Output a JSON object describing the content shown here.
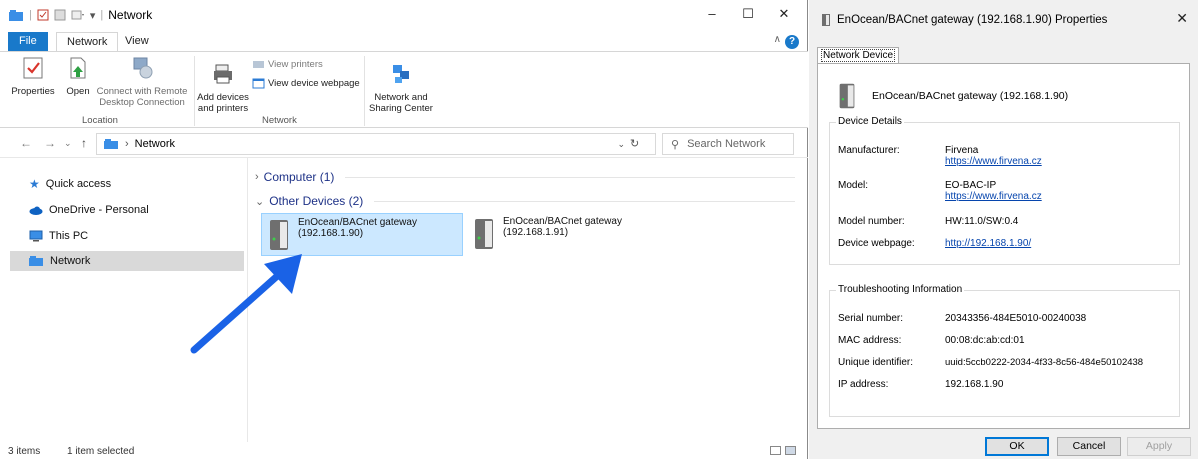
{
  "explorer": {
    "title": "Network",
    "tabs": {
      "file": "File",
      "network": "Network",
      "view": "View"
    },
    "ribbon": {
      "location_group": "Location",
      "network_group": "Network",
      "properties": "Properties",
      "open": "Open",
      "connect_remote_1": "Connect with Remote",
      "connect_remote_2": "Desktop Connection",
      "add_devices_1": "Add devices",
      "add_devices_2": "and printers",
      "view_printers": "View printers",
      "view_device_webpage": "View device webpage",
      "network_sharing_1": "Network and",
      "network_sharing_2": "Sharing Center"
    },
    "address": {
      "path": "Network",
      "search_placeholder": "Search Network"
    },
    "nav": {
      "quick_access": "Quick access",
      "onedrive": "OneDrive - Personal",
      "this_pc": "This PC",
      "network": "Network"
    },
    "sections": {
      "computer": "Computer (1)",
      "other_devices": "Other Devices (2)"
    },
    "devices": [
      {
        "name": "EnOcean/BACnet gateway",
        "ip": "(192.168.1.90)"
      },
      {
        "name": "EnOcean/BACnet gateway",
        "ip": "(192.168.1.91)"
      }
    ],
    "status": {
      "items": "3 items",
      "selected": "1 item selected"
    }
  },
  "properties": {
    "title": "EnOcean/BACnet gateway (192.168.1.90) Properties",
    "tab": "Network Device",
    "device_name": "EnOcean/BACnet gateway (192.168.1.90)",
    "details_legend": "Device Details",
    "manufacturer_label": "Manufacturer:",
    "manufacturer_value": "Firvena",
    "manufacturer_link": "https://www.firvena.cz",
    "model_label": "Model:",
    "model_value": "EO-BAC-IP",
    "model_link": "https://www.firvena.cz",
    "model_number_label": "Model number:",
    "model_number_value": "HW:11.0/SW:0.4",
    "webpage_label": "Device webpage:",
    "webpage_value": "http://192.168.1.90/",
    "troubleshooting_legend": "Troubleshooting Information",
    "serial_label": "Serial number:",
    "serial_value": "20343356-484E5010-00240038",
    "mac_label": "MAC address:",
    "mac_value": "00:08:dc:ab:cd:01",
    "uid_label": "Unique identifier:",
    "uid_value": "uuid:5ccb0222-2034-4f33-8c56-484e50102438",
    "ip_label": "IP address:",
    "ip_value": "192.168.1.90",
    "buttons": {
      "ok": "OK",
      "cancel": "Cancel",
      "apply": "Apply"
    }
  },
  "colors": {
    "accent": "#1979ca",
    "selection": "#cce8ff",
    "arrow": "#1a62e6",
    "link": "#0645ad"
  }
}
